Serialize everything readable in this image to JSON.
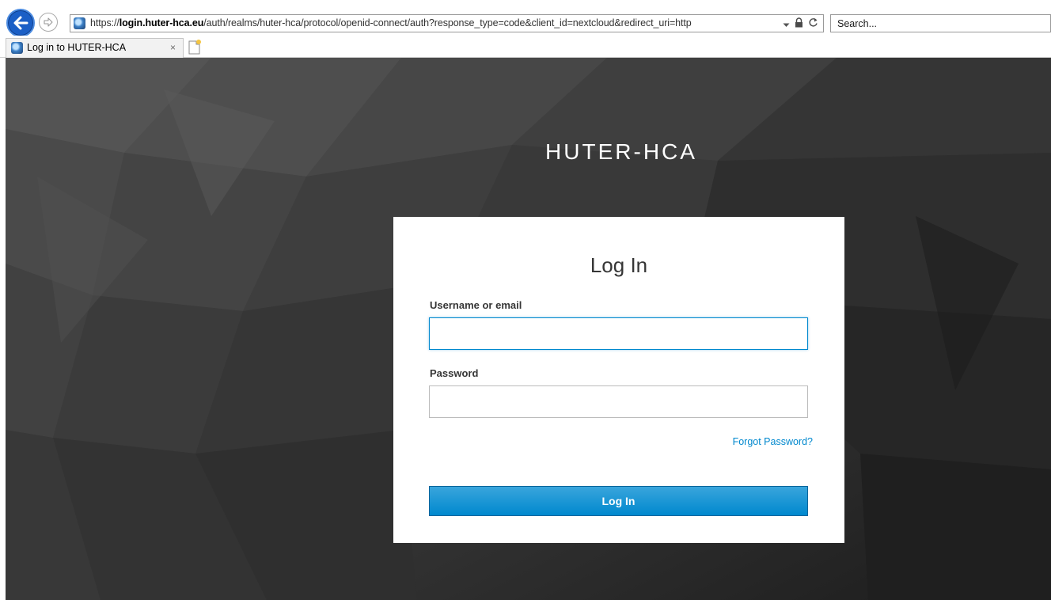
{
  "browser": {
    "address": {
      "scheme": "https://",
      "host": "login.huter-hca.eu",
      "path": "/auth/realms/huter-hca/protocol/openid-connect/auth?response_type=code&client_id=nextcloud&redirect_uri=http"
    },
    "search": {
      "placeholder": "Search..."
    },
    "tab": {
      "title": "Log in to HUTER-HCA",
      "close_glyph": "×"
    }
  },
  "login": {
    "realm_title": "HUTER-HCA",
    "card_title": "Log In",
    "username_label": "Username or email",
    "username_value": "",
    "password_label": "Password",
    "password_value": "",
    "forgot_password": "Forgot Password?",
    "submit_label": "Log In"
  },
  "icons": {
    "back": "arrow-left-icon",
    "forward": "arrow-right-icon",
    "site": "site-favicon-icon",
    "dropdown": "chevron-down-icon",
    "lock": "lock-icon",
    "refresh": "refresh-icon",
    "new_tab": "new-tab-icon"
  },
  "colors": {
    "accent": "#0088ce",
    "nav_back": "#1b5fc6",
    "page_bg": "#303030",
    "card_bg": "#ffffff"
  }
}
